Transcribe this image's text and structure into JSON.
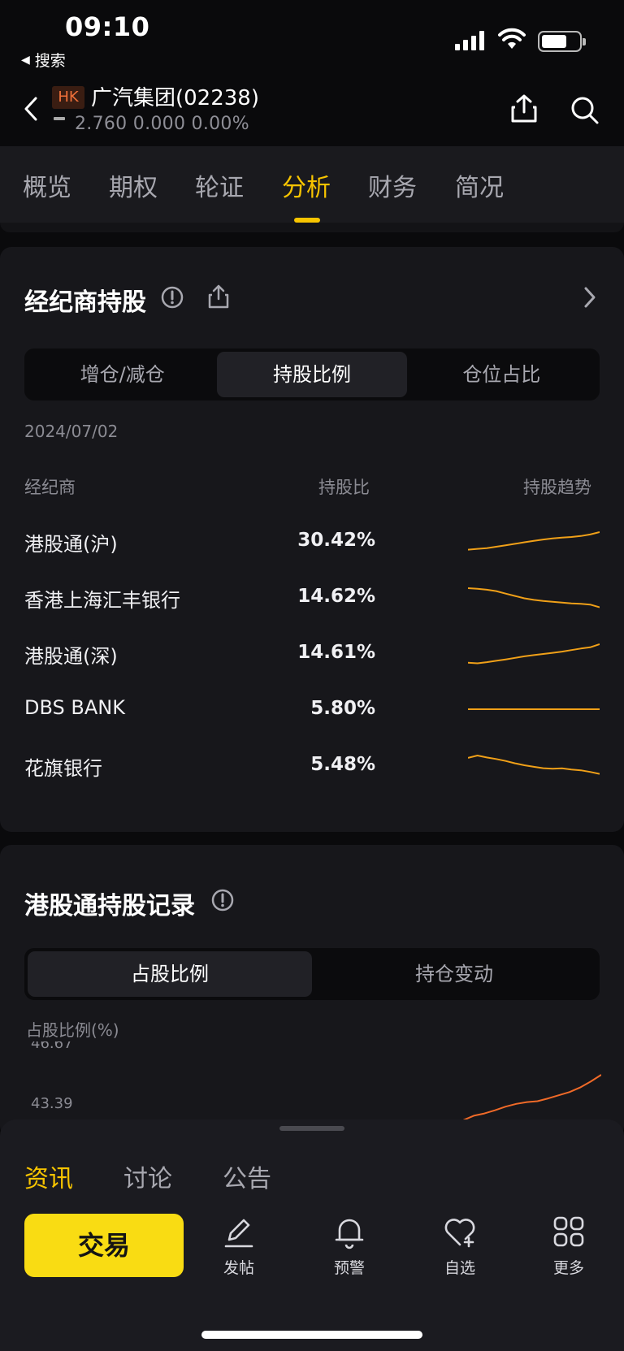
{
  "status_bar": {
    "time": "09:10",
    "back_label": "搜索"
  },
  "stock": {
    "market_badge": "HK",
    "name": "广汽集团(02238)",
    "price_line": "2.760  0.000  0.00%"
  },
  "tabs": [
    {
      "label": "概览"
    },
    {
      "label": "期权"
    },
    {
      "label": "轮证"
    },
    {
      "label": "分析",
      "active": true
    },
    {
      "label": "财务"
    },
    {
      "label": "简况"
    }
  ],
  "broker_card": {
    "title": "经纪商持股",
    "segments": [
      {
        "label": "增仓/减仓"
      },
      {
        "label": "持股比例",
        "active": true
      },
      {
        "label": "仓位占比"
      }
    ],
    "date": "2024/07/02",
    "headers": {
      "broker": "经纪商",
      "ratio": "持股比",
      "trend": "持股趋势"
    },
    "rows": [
      {
        "name": "港股通(沪)",
        "ratio": "30.42%",
        "trend": [
          0.1,
          0.14,
          0.18,
          0.25,
          0.32,
          0.4,
          0.48,
          0.55,
          0.62,
          0.68,
          0.72,
          0.75,
          0.8,
          0.88,
          1.0
        ]
      },
      {
        "name": "香港上海汇丰银行",
        "ratio": "14.62%",
        "trend": [
          1.0,
          0.97,
          0.92,
          0.85,
          0.72,
          0.6,
          0.48,
          0.4,
          0.34,
          0.3,
          0.26,
          0.22,
          0.2,
          0.16,
          0.02
        ]
      },
      {
        "name": "港股通(深)",
        "ratio": "14.61%",
        "trend": [
          0.05,
          0.02,
          0.08,
          0.15,
          0.22,
          0.3,
          0.38,
          0.44,
          0.5,
          0.56,
          0.62,
          0.7,
          0.78,
          0.84,
          1.0
        ]
      },
      {
        "name": "DBS BANK",
        "ratio": "5.80%",
        "trend": [
          0.5,
          0.5,
          0.5,
          0.5,
          0.5,
          0.5,
          0.5,
          0.5,
          0.5,
          0.5,
          0.5,
          0.5,
          0.5,
          0.5,
          0.5
        ]
      },
      {
        "name": "花旗银行",
        "ratio": "5.48%",
        "trend": [
          0.88,
          1.0,
          0.9,
          0.82,
          0.72,
          0.6,
          0.5,
          0.42,
          0.35,
          0.32,
          0.34,
          0.28,
          0.24,
          0.16,
          0.06
        ]
      }
    ]
  },
  "southbound_card": {
    "title": "港股通持股记录",
    "segments": [
      {
        "label": "占股比例",
        "active": true
      },
      {
        "label": "持仓变动"
      }
    ],
    "y_label": "占股比例(%)",
    "y_ticks": [
      "46.67",
      "43.39"
    ],
    "series_trend": [
      0.0,
      0.1,
      0.15,
      0.22,
      0.3,
      0.36,
      0.4,
      0.42,
      0.48,
      0.55,
      0.62,
      0.72,
      0.85,
      1.0
    ]
  },
  "news_tabs": [
    {
      "label": "资讯",
      "active": true
    },
    {
      "label": "讨论"
    },
    {
      "label": "公告"
    }
  ],
  "bottom_bar": {
    "trade": "交易",
    "items": [
      {
        "label": "发帖",
        "icon": "pencil-icon"
      },
      {
        "label": "预警",
        "icon": "bell-icon"
      },
      {
        "label": "自选",
        "icon": "heart-plus-icon"
      },
      {
        "label": "更多",
        "icon": "grid-icon"
      }
    ]
  },
  "colors": {
    "accent": "#f7c400",
    "trend_line": "#f0a018",
    "chart_line": "#f06a28",
    "trade_button": "#f9dc13"
  }
}
